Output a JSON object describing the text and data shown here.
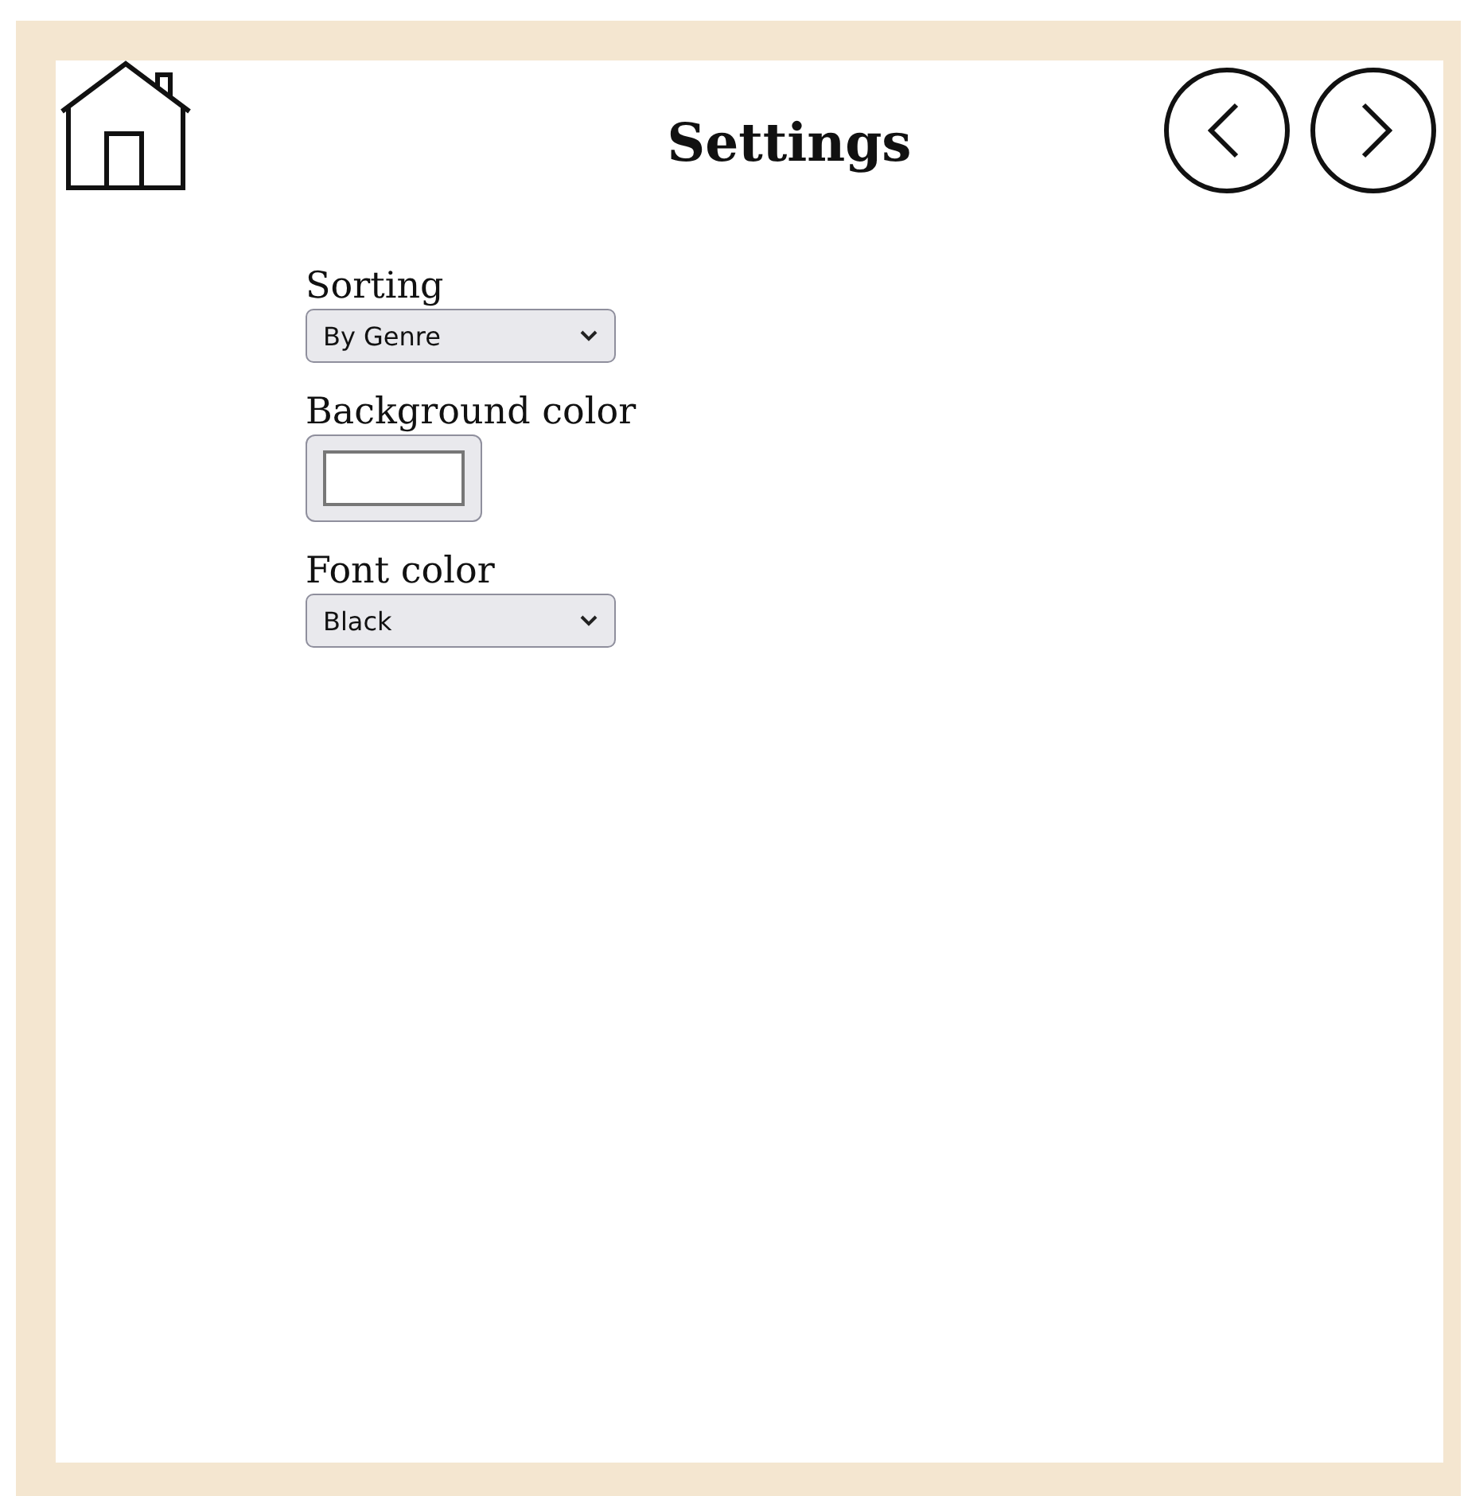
{
  "title": "Settings",
  "fields": [
    {
      "label": "Sorting",
      "kind": "select",
      "value": "By Genre"
    },
    {
      "label": "Background color",
      "kind": "color",
      "color": "#ffffff"
    },
    {
      "label": "Font color",
      "kind": "select",
      "value": "Black"
    }
  ]
}
